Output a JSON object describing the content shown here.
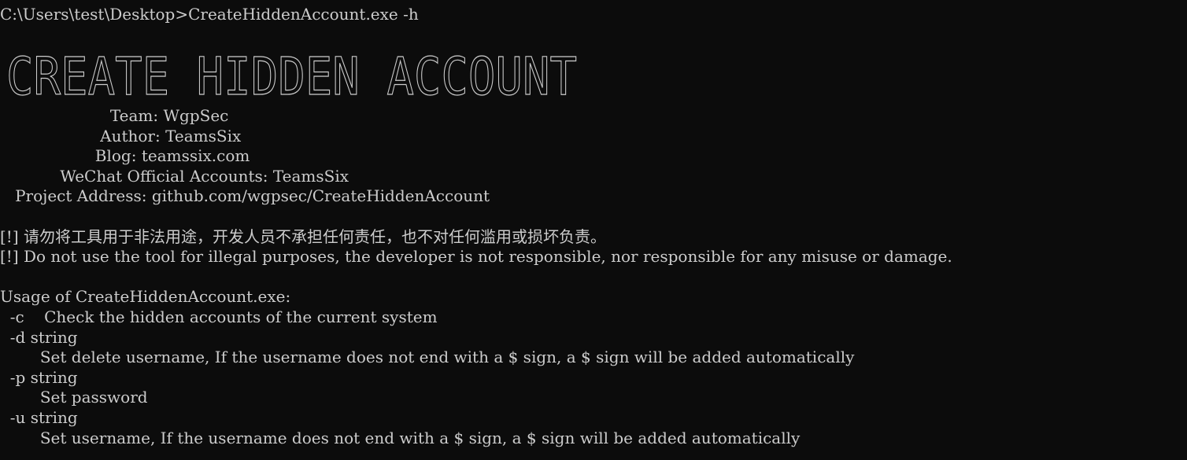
{
  "terminal": {
    "prompt_line": "C:\\Users\\test\\Desktop>CreateHiddenAccount.exe -h",
    "banner_text": "CREATE HIDDEN ACCOUNT",
    "info": [
      {
        "text": "                      Team: WgpSec"
      },
      {
        "text": "                    Author: TeamsSix"
      },
      {
        "text": "                   Blog: teamssix.com"
      },
      {
        "text": "            WeChat Official Accounts: TeamsSix"
      },
      {
        "text": "   Project Address: github.com/wgpsec/CreateHiddenAccount"
      }
    ],
    "warnings": [
      {
        "text": "[!] 请勿将工具用于非法用途，开发人员不承担任何责任，也不对任何滥用或损坏负责。"
      },
      {
        "text": "[!] Do not use the tool for illegal purposes, the developer is not responsible, nor responsible for any misuse or damage."
      }
    ],
    "usage_title": "Usage of CreateHiddenAccount.exe:",
    "usage": [
      {
        "text": "  -c    Check the hidden accounts of the current system"
      },
      {
        "text": "  -d string"
      },
      {
        "text": "        Set delete username, If the username does not end with a $ sign, a $ sign will be added automatically"
      },
      {
        "text": "  -p string"
      },
      {
        "text": "        Set password"
      },
      {
        "text": "  -u string"
      },
      {
        "text": "        Set username, If the username does not end with a $ sign, a $ sign will be added automatically"
      }
    ]
  },
  "colors": {
    "background": "#0c0c0c",
    "foreground": "#cccccc"
  }
}
